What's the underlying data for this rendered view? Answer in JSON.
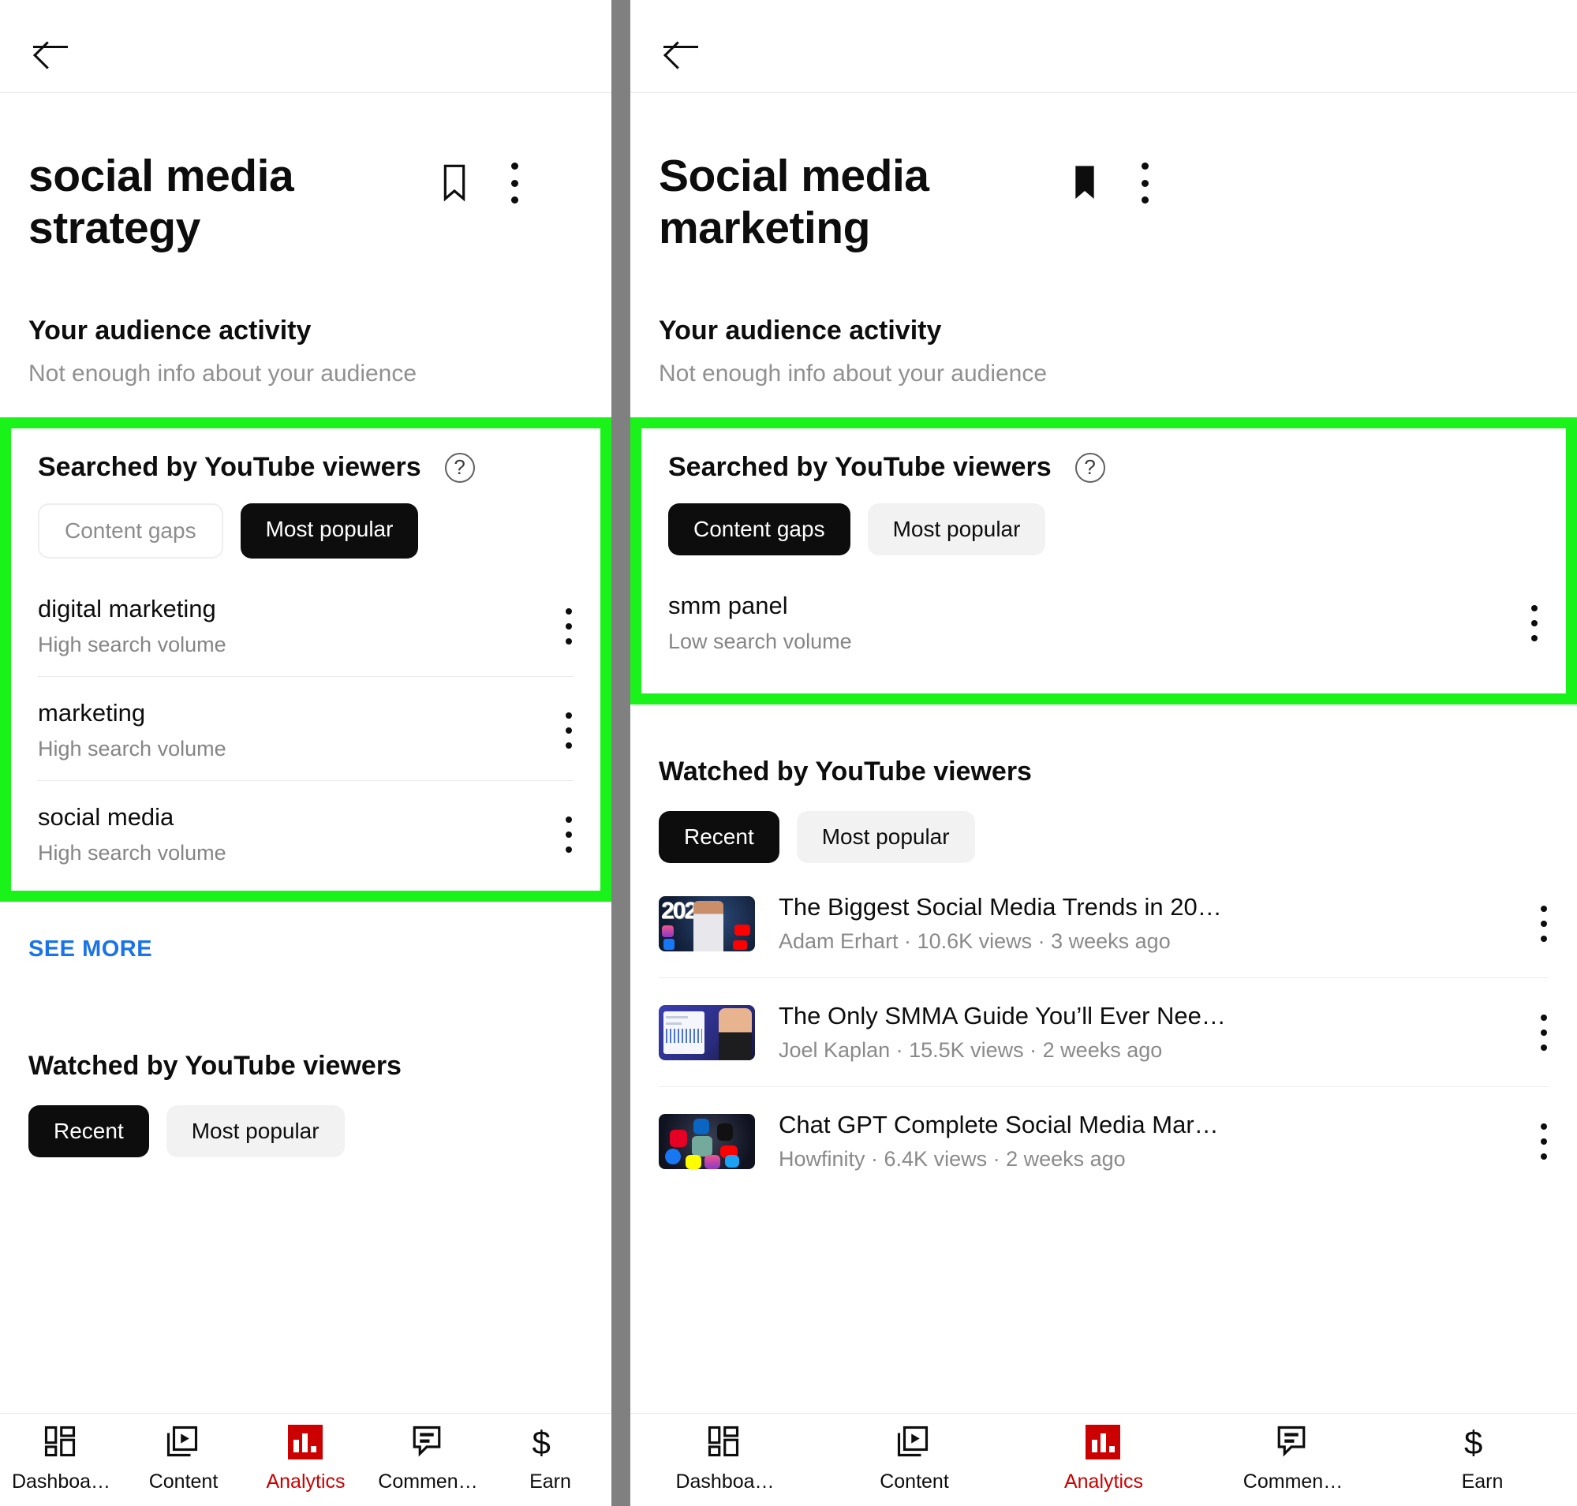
{
  "colors": {
    "highlight_green": "#19F319",
    "accent_red": "#CC0000",
    "link_blue": "#1A73E8",
    "divider_grey": "#808080",
    "chip_active_bg": "#0D0D0D",
    "chip_grey_bg": "#F2F2F2"
  },
  "left_panel": {
    "back_icon": "back-arrow-icon",
    "keyword_title": "social media strategy",
    "bookmark_icon": "bookmark-outline-icon",
    "overflow_icon": "kebab-menu-icon",
    "audience": {
      "heading": "Your audience activity",
      "subtext": "Not enough info about your audience"
    },
    "searched_card": {
      "heading": "Searched by YouTube viewers",
      "help_icon": "help-circle-icon",
      "help_glyph": "?",
      "chips": [
        {
          "label": "Content gaps",
          "state": "outline"
        },
        {
          "label": "Most popular",
          "state": "active"
        }
      ],
      "keywords": [
        {
          "name": "digital marketing",
          "volume": "High search volume",
          "overflow_icon": "kebab-menu-icon"
        },
        {
          "name": "marketing",
          "volume": "High search volume",
          "overflow_icon": "kebab-menu-icon"
        },
        {
          "name": "social media",
          "volume": "High search volume",
          "overflow_icon": "kebab-menu-icon"
        }
      ],
      "highlighted": true
    },
    "see_more_label": "SEE MORE",
    "watched_card": {
      "heading": "Watched by YouTube viewers",
      "chips": [
        {
          "label": "Recent",
          "state": "active"
        },
        {
          "label": "Most popular",
          "state": "grey"
        }
      ],
      "videos": []
    }
  },
  "right_panel": {
    "back_icon": "back-arrow-icon",
    "keyword_title": "Social media marketing",
    "bookmark_icon": "bookmark-filled-icon",
    "overflow_icon": "kebab-menu-icon",
    "audience": {
      "heading": "Your audience activity",
      "subtext": "Not enough info about your audience"
    },
    "searched_card": {
      "heading": "Searched by YouTube viewers",
      "help_icon": "help-circle-icon",
      "help_glyph": "?",
      "chips": [
        {
          "label": "Content gaps",
          "state": "active"
        },
        {
          "label": "Most popular",
          "state": "grey"
        }
      ],
      "keywords": [
        {
          "name": "smm panel",
          "volume": "Low search volume",
          "overflow_icon": "kebab-menu-icon"
        }
      ],
      "highlighted": true
    },
    "watched_card": {
      "heading": "Watched by YouTube viewers",
      "chips": [
        {
          "label": "Recent",
          "state": "active"
        },
        {
          "label": "Most popular",
          "state": "grey"
        }
      ],
      "videos": [
        {
          "thumb": "thumbnail-2023-social-trends",
          "thumb_text": "2023",
          "title": "The Biggest Social Media Trends in 20…",
          "channel": "Adam Erhart",
          "views": "10.6K views",
          "age": "3 weeks ago",
          "meta": "Adam Erhart · 10.6K views · 3 weeks ago",
          "overflow_icon": "kebab-menu-icon"
        },
        {
          "thumb": "thumbnail-smma-guide",
          "thumb_text": "",
          "title": "The Only SMMA Guide You’ll Ever Nee…",
          "channel": "Joel Kaplan",
          "views": "15.5K views",
          "age": "2 weeks ago",
          "meta": "Joel Kaplan · 15.5K views · 2 weeks ago",
          "overflow_icon": "kebab-menu-icon"
        },
        {
          "thumb": "thumbnail-chatgpt-social-icons",
          "thumb_text": "",
          "title": "Chat GPT Complete Social Media Mar…",
          "channel": "Howfinity",
          "views": "6.4K views",
          "age": "2 weeks ago",
          "meta": "Howfinity · 6.4K views · 2 weeks ago",
          "overflow_icon": "kebab-menu-icon"
        }
      ]
    }
  },
  "bottom_nav": {
    "items": [
      {
        "label": "Dashboa…",
        "icon": "dashboard-grid-icon",
        "active": false
      },
      {
        "label": "Content",
        "icon": "content-video-icon",
        "active": false
      },
      {
        "label": "Analytics",
        "icon": "analytics-bars-icon",
        "active": true
      },
      {
        "label": "Commen…",
        "icon": "comment-bubble-icon",
        "active": false
      },
      {
        "label": "Earn",
        "icon": "dollar-sign-icon",
        "active": false
      }
    ]
  }
}
